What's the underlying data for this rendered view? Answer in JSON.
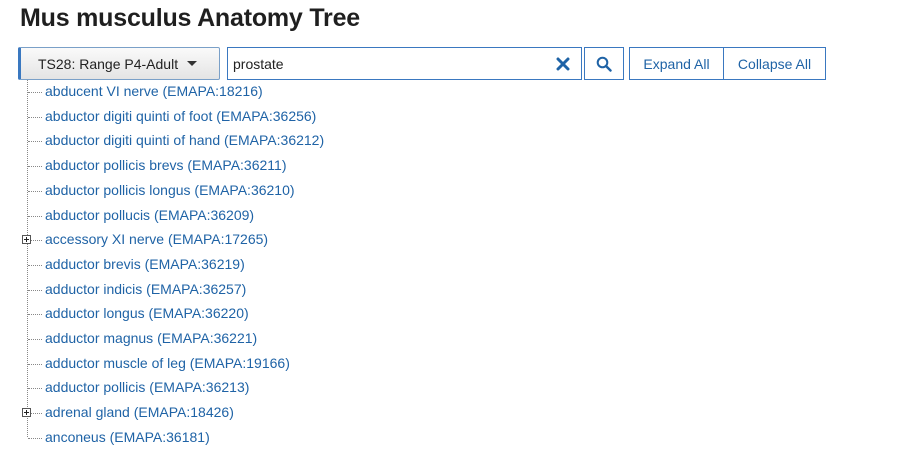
{
  "page": {
    "title": "Mus musculus Anatomy Tree"
  },
  "toolbar": {
    "stage_label": "TS28: Range P4-Adult",
    "search_value": "prostate",
    "expand_all": "Expand All",
    "collapse_all": "Collapse All"
  },
  "colors": {
    "link": "#1f63a6",
    "border": "#3a78c0"
  },
  "tree": {
    "nodes": [
      {
        "label": "abducent VI nerve (EMAPA:18216)",
        "expandable": false
      },
      {
        "label": "abductor digiti quinti of foot (EMAPA:36256)",
        "expandable": false
      },
      {
        "label": "abductor digiti quinti of hand (EMAPA:36212)",
        "expandable": false
      },
      {
        "label": "abductor pollicis brevs (EMAPA:36211)",
        "expandable": false
      },
      {
        "label": "abductor pollicis longus (EMAPA:36210)",
        "expandable": false
      },
      {
        "label": "abductor pollucis (EMAPA:36209)",
        "expandable": false
      },
      {
        "label": "accessory XI nerve (EMAPA:17265)",
        "expandable": true
      },
      {
        "label": "adductor brevis (EMAPA:36219)",
        "expandable": false
      },
      {
        "label": "adductor indicis (EMAPA:36257)",
        "expandable": false
      },
      {
        "label": "adductor longus (EMAPA:36220)",
        "expandable": false
      },
      {
        "label": "adductor magnus (EMAPA:36221)",
        "expandable": false
      },
      {
        "label": "adductor muscle of leg (EMAPA:19166)",
        "expandable": false
      },
      {
        "label": "adductor pollicis (EMAPA:36213)",
        "expandable": false
      },
      {
        "label": "adrenal gland (EMAPA:18426)",
        "expandable": true
      },
      {
        "label": "anconeus (EMAPA:36181)",
        "expandable": false
      }
    ]
  }
}
